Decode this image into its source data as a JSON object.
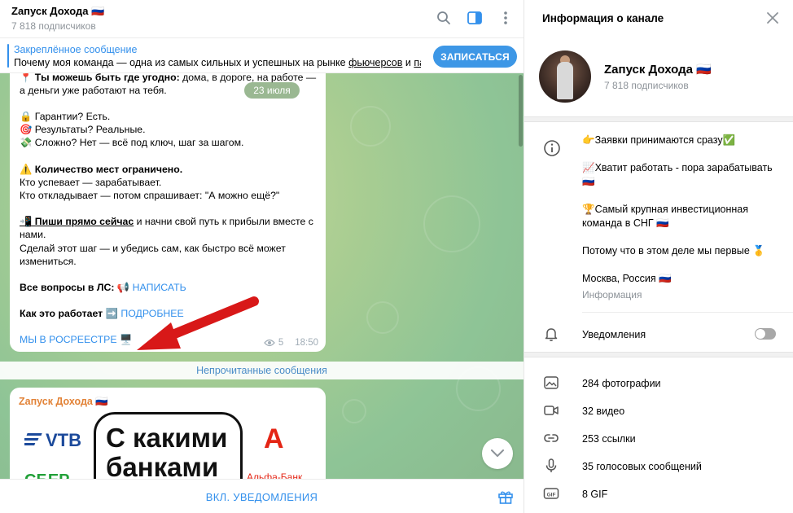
{
  "chat": {
    "title": "Zапуск Дохода 🇷🇺",
    "subscribers": "7 818 подписчиков",
    "header_icons": [
      "search-icon",
      "sidebar-toggle-icon",
      "more-vertical-icon"
    ]
  },
  "pinned": {
    "title": "Закреплённое сообщение",
    "text_prefix": "Почему моя команда — одна из самых сильных и успешных на рынке ",
    "text_link1": "фьючерсов",
    "text_mid": " и ",
    "text_link2": "па...",
    "button_label": "ЗАПИСАТЬСЯ"
  },
  "message1": {
    "line1_bold": "📍 Ты можешь быть где угодно:",
    "line1_rest": " дома, в дороге, на работе —",
    "line2": "а деньги уже работают на тебя.",
    "date_pill": "23 июля",
    "line3": "🔒 Гарантии? Есть.",
    "line4": "🎯 Результаты? Реальные.",
    "line5": "💸 Сложно? Нет — всё под ключ, шаг за шагом.",
    "line6_bold": "⚠️ Количество мест ограничено.",
    "line7": "Кто успевает — зарабатывает.",
    "line8": "Кто откладывает — потом спрашивает: \"А можно ещё?\"",
    "line9_bold": "📲 Пиши прямо сейчас",
    "line9_rest": " и начни свой путь к прибыли вместе с",
    "line10": "нами.",
    "line11": "Сделай этот шаг — и убедись сам, как быстро всё может",
    "line12": "измениться.",
    "line13_bold": "Все вопросы в ЛС:",
    "line13_emoji": " 📢 ",
    "line13_link": "НАПИСАТЬ",
    "line14_bold": "Как это работает",
    "line14_emoji": " ➡️ ",
    "line14_link": "ПОДРОБНЕЕ",
    "line15_link": "МЫ В РОСРЕЕСТРЕ",
    "line15_emoji": " 🖥️",
    "views": "5",
    "time": "18:50"
  },
  "unread_label": "Непрочитанные сообщения",
  "message2": {
    "author": "Zапуск Дохода 🇷🇺",
    "banner_line1": "С какими",
    "banner_line2": "банками",
    "logo_vtb": "VTB",
    "logo_sber": "СБЕР",
    "logo_alfa_letter": "А",
    "logo_alfa_text": "Альфа-Банк"
  },
  "footer": {
    "notify_label": "ВКЛ. УВЕДОМЛЕНИЯ"
  },
  "info": {
    "title": "Информация о канале",
    "channel_name": "Zапуск Дохода 🇷🇺",
    "channel_subs": "7 818 подписчиков",
    "desc1": "👉Заявки принимаются сразу✅",
    "desc2": "📈Хватит работать - пора зарабатывать 🇷🇺",
    "desc3": "🏆Самый крупная инвестиционная команда в СНГ 🇷🇺",
    "desc4": "Потому что в этом деле мы первые 🥇",
    "desc5": "Москва, Россия 🇷🇺",
    "desc_caption": "Информация",
    "notifications_label": "Уведомления",
    "notifications_on": false,
    "media": [
      {
        "icon": "photo-icon",
        "label": "284 фотографии"
      },
      {
        "icon": "video-icon",
        "label": "32 видео"
      },
      {
        "icon": "link-icon",
        "label": "253 ссылки"
      },
      {
        "icon": "microphone-icon",
        "label": "35 голосовых сообщений"
      },
      {
        "icon": "gif-icon",
        "label": "8 GIF"
      }
    ]
  },
  "colors": {
    "accent": "#3390ec",
    "author": "#e28338",
    "arrow": "#d81818"
  }
}
